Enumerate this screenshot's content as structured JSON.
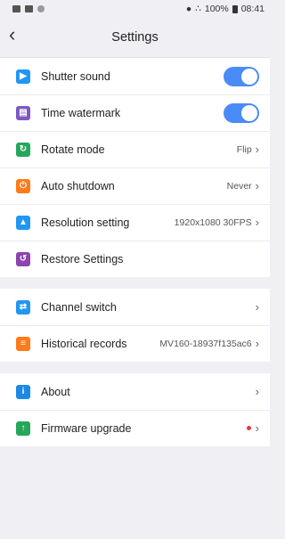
{
  "statusbar": {
    "signal_text": "100%",
    "time": "08:41"
  },
  "header": {
    "title": "Settings"
  },
  "group1": [
    {
      "name": "shutter-sound",
      "label": "Shutter sound",
      "icon": "speaker-icon",
      "color": "#2196f3",
      "toggle": true
    },
    {
      "name": "time-watermark",
      "label": "Time watermark",
      "icon": "time-watermark-icon",
      "color": "#7e57c2",
      "toggle": true
    },
    {
      "name": "rotate-mode",
      "label": "Rotate mode",
      "icon": "rotate-icon",
      "color": "#26a65b",
      "value": "Flip"
    },
    {
      "name": "auto-shutdown",
      "label": "Auto shutdown",
      "icon": "power-icon",
      "color": "#ff7a1a",
      "value": "Never"
    },
    {
      "name": "resolution-setting",
      "label": "Resolution setting",
      "icon": "resolution-icon",
      "color": "#2196f3",
      "value": "1920x1080 30FPS"
    },
    {
      "name": "restore-settings",
      "label": "Restore Settings",
      "icon": "restore-icon",
      "color": "#8e44ad"
    }
  ],
  "group2": [
    {
      "name": "channel-switch",
      "label": "Channel switch",
      "icon": "switch-icon",
      "color": "#2196f3"
    },
    {
      "name": "historical-records",
      "label": "Historical records",
      "icon": "records-icon",
      "color": "#ff7a1a",
      "value": "MV160-18937f135ac6"
    }
  ],
  "group3": [
    {
      "name": "about",
      "label": "About",
      "icon": "info-icon",
      "color": "#1e88e5"
    },
    {
      "name": "firmware-upgrade",
      "label": "Firmware upgrade",
      "icon": "upgrade-icon",
      "color": "#26a65b",
      "dot": true
    }
  ]
}
